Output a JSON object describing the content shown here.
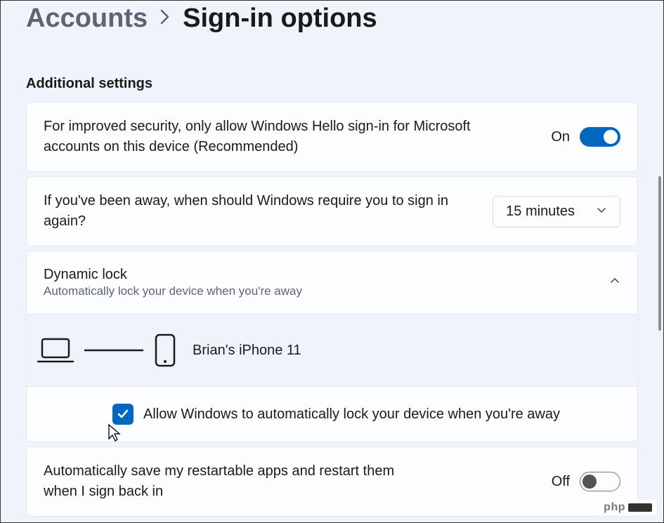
{
  "breadcrumb": {
    "parent": "Accounts",
    "current": "Sign-in options"
  },
  "section_heading": "Additional settings",
  "hello_signin": {
    "text": "For improved security, only allow Windows Hello sign-in for Microsoft accounts on this device (Recommended)",
    "state_label": "On",
    "state": true
  },
  "require_signin": {
    "text": "If you've been away, when should Windows require you to sign in again?",
    "selected": "15 minutes"
  },
  "dynamic_lock": {
    "title": "Dynamic lock",
    "subtitle": "Automatically lock your device when you're away",
    "device_name": "Brian's iPhone 11",
    "checkbox_label": "Allow Windows to automatically lock your device when you're away",
    "checkbox_checked": true
  },
  "restartable_apps": {
    "text": "Automatically save my restartable apps and restart them when I sign back in",
    "state_label": "Off",
    "state": false
  },
  "watermark": "php"
}
